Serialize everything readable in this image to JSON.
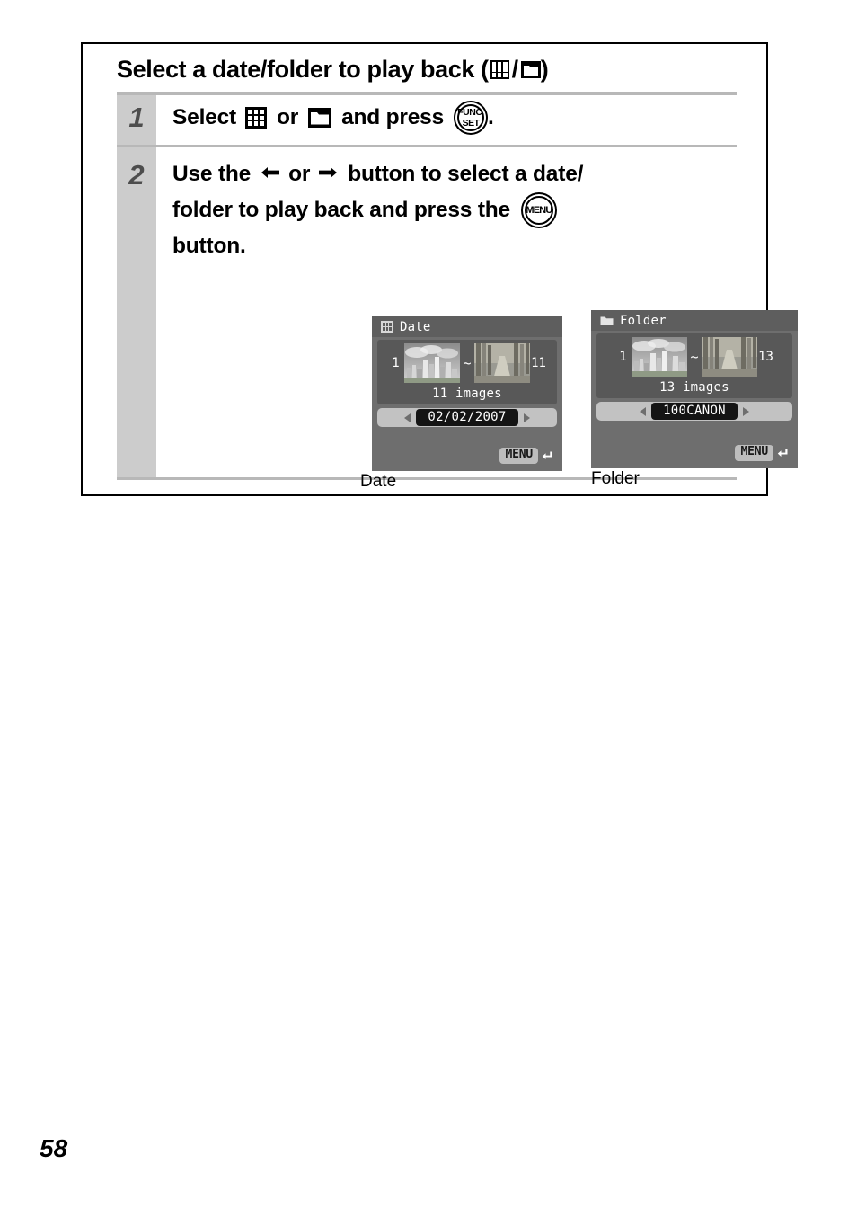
{
  "page": {
    "number": "58"
  },
  "section": {
    "title_text": "Select a date/folder to play back (",
    "title_sep": "/",
    "title_close": ")",
    "title_icon_calendar": "calendar-icon",
    "title_icon_folder": "folder-icon"
  },
  "steps": [
    {
      "number": "1",
      "parts": {
        "p1": "Select",
        "icon_calendar": "calendar-icon",
        "p2": "or",
        "icon_folder": "folder-icon",
        "p3": "and press",
        "button_line1": "FUNC.",
        "button_line2": "SET",
        "p4": "."
      }
    },
    {
      "number": "2",
      "parts": {
        "p1": "Use the",
        "arrow_left": "⬅",
        "p2": "or",
        "arrow_right": "➡",
        "p3": "button to select a date/",
        "p4": "folder to play back and press the",
        "button_label": "MENU",
        "p5": "button."
      }
    }
  ],
  "screens": [
    {
      "id": "date",
      "header_icon": "calendar-icon",
      "header_label": "Date",
      "start_index": "1",
      "tilde": "~",
      "end_index": "11",
      "images_count": "11 images",
      "selector_value": "02/02/2007",
      "menu_label": "MENU",
      "caption": "Date"
    },
    {
      "id": "folder",
      "header_icon": "folder-icon",
      "header_label": "Folder",
      "start_index": "1",
      "tilde": "~",
      "end_index": "13",
      "images_count": "13 images",
      "selector_value": "100CANON",
      "menu_label": "MENU",
      "caption": "Folder"
    }
  ],
  "colors": {
    "screen_bg": "#6e6e6e",
    "screen_header_bg": "#5e5e5e",
    "screen_body_bg": "#585858",
    "selector_bg": "#c2c2c2",
    "selector_value_bg": "#141414",
    "step_column_bg": "#cccccc",
    "rule": "#b8b8b8",
    "step_number": "#4d4d4d"
  }
}
